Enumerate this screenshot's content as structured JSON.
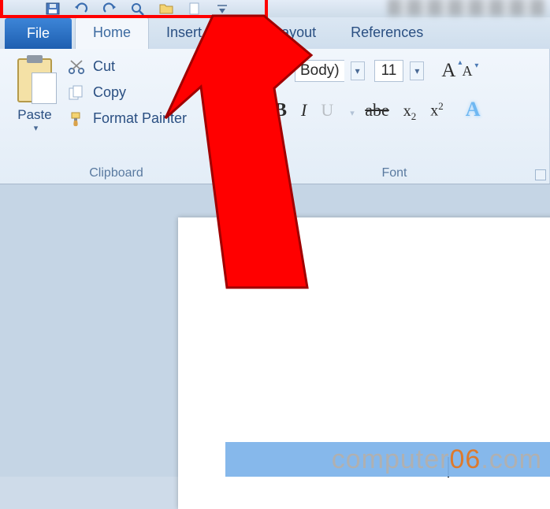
{
  "qat": {
    "icons": [
      "word-icon",
      "save-icon",
      "undo-icon",
      "redo-icon",
      "print-preview-icon",
      "zoom-icon",
      "customize-qat-icon"
    ]
  },
  "tabs": {
    "file": "File",
    "home": "Home",
    "insert": "Insert",
    "page_layout": "Page Layout",
    "references": "References",
    "active": "home"
  },
  "clipboard": {
    "group_label": "Clipboard",
    "paste_label": "Paste",
    "cut_label": "Cut",
    "copy_label": "Copy",
    "format_painter_label": "Format Painter"
  },
  "font": {
    "group_label": "Font",
    "font_name_tail": "Body)",
    "font_size": "11"
  },
  "watermark": {
    "part1": "computer",
    "part2": "06",
    "part3": ".com"
  }
}
